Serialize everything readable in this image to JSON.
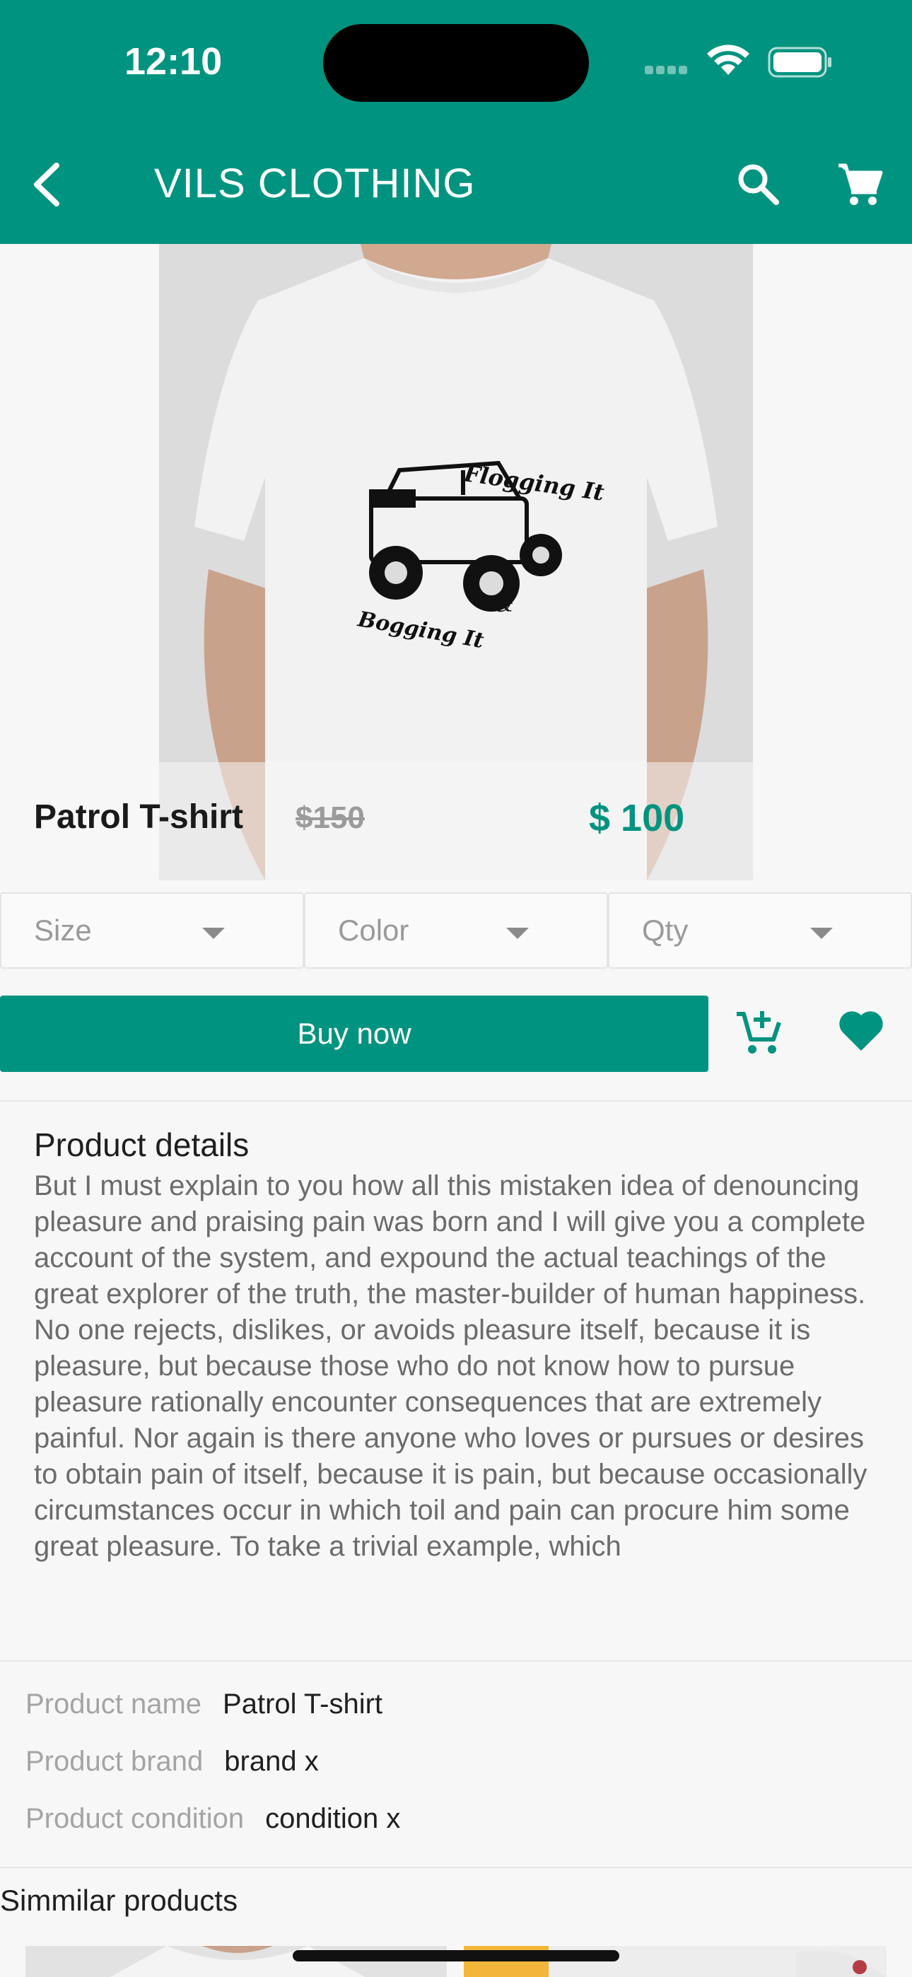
{
  "status": {
    "time": "12:10"
  },
  "appbar": {
    "title": "VILS CLOTHING"
  },
  "product": {
    "name": "Patrol T-shirt",
    "old_price": "$150",
    "price": "$ 100",
    "shirt_print": {
      "line1": "Flogging It",
      "line2": "Bogging It",
      "amp": "&"
    }
  },
  "selectors": [
    {
      "label": "Size"
    },
    {
      "label": "Color"
    },
    {
      "label": "Qty"
    }
  ],
  "actions": {
    "buy_label": "Buy now"
  },
  "details": {
    "title": "Product details",
    "body": "But I must explain to you how all this mistaken idea of denouncing pleasure and praising pain was born and I will give you a complete account of the system, and expound the actual teachings of the great explorer of the truth, the master-builder of human happiness. No one rejects, dislikes, or avoids pleasure itself, because it is pleasure, but because those who do not know how to pursue pleasure rationally encounter consequences that are extremely painful. Nor again is there anyone who loves or pursues or desires to obtain pain of itself, because it is pain, but because occasionally circumstances occur in which toil and pain can procure him some great pleasure. To take a trivial example, which"
  },
  "specs": [
    {
      "key": "Product name",
      "value": "Patrol T-shirt"
    },
    {
      "key": "Product brand",
      "value": "brand x"
    },
    {
      "key": "Product condition",
      "value": "condition x"
    }
  ],
  "similar": {
    "title": "Simmilar products"
  },
  "colors": {
    "primary": "#00937f",
    "muted_text": "#6b6b6b"
  }
}
